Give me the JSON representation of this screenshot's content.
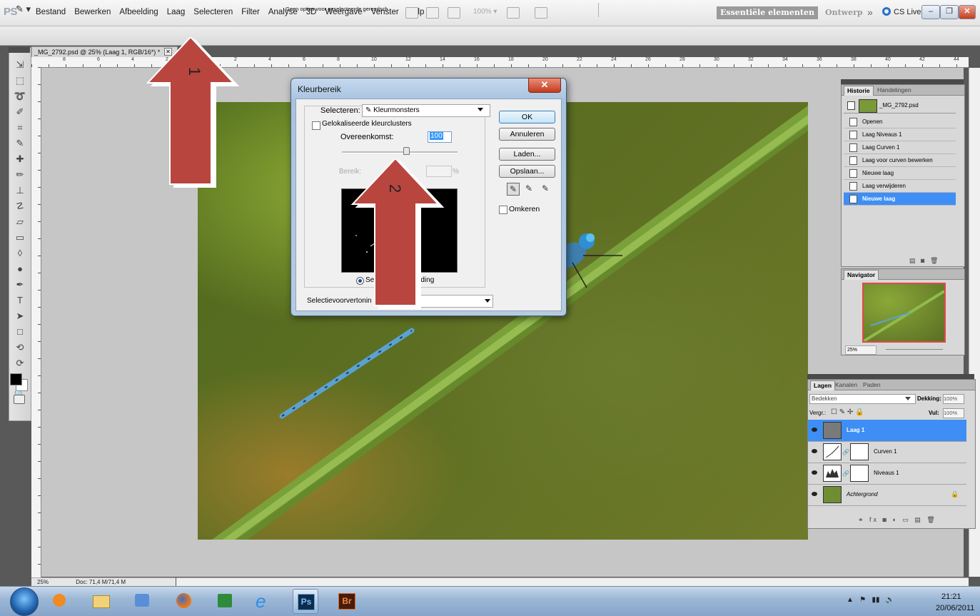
{
  "menubar": {
    "logo": "PS",
    "items": [
      "Bestand",
      "Bewerken",
      "Afbeelding",
      "Laag",
      "Selecteren",
      "Filter",
      "Analyse",
      "3D",
      "Weergave",
      "Venster",
      "Help"
    ],
    "zoom": "100% ▾",
    "workspace_active": "Essentiële elementen",
    "workspace_design": "Ontwerp",
    "more": "»",
    "cslive": "CS Live ▾"
  },
  "options_bar": {
    "message": "Geen opties voor geselecteerde gereedsch."
  },
  "document": {
    "tab_title": "_MG_2792.psd @ 25% (Laag 1, RGB/16*) *",
    "ruler_top_numbers": [
      "8",
      "6",
      "4",
      "2",
      "0",
      "2",
      "4",
      "6",
      "8",
      "10",
      "12",
      "14",
      "16",
      "18",
      "20",
      "22",
      "24",
      "26",
      "28",
      "30",
      "32",
      "34",
      "36",
      "38",
      "40",
      "42",
      "44"
    ],
    "status_zoom": "25%",
    "status_doc": "Doc: 71,4 M/71,4 M"
  },
  "dialog": {
    "title": "Kleurbereik",
    "select_label": "Selecteren:",
    "select_value": "Kleurmonsters",
    "localized_label": "Gelokaliseerde kleurclusters",
    "fuzziness_label": "Overeenkomst:",
    "fuzziness_value": "100",
    "fuzziness_level_pct": 55,
    "range_label": "Bereik:",
    "range_unit": "%",
    "radio_selection": "Sele",
    "radio_image": "eelding",
    "preview_label": "Selectievoorvertonin",
    "buttons": {
      "ok": "OK",
      "cancel": "Annuleren",
      "load": "Laden...",
      "save": "Opslaan..."
    },
    "invert_label": "Omkeren"
  },
  "annotations": {
    "arrow1": "1",
    "arrow2": "2",
    "arrow_color": "#b8463f"
  },
  "history_panel": {
    "tabs": [
      "Historie",
      "Handelingen"
    ],
    "snapshot": "_MG_2792.psd",
    "items": [
      "Openen",
      "Laag Niveaus 1",
      "Laag Curven 1",
      "Laag voor curven bewerken",
      "Nieuwe laag",
      "Laag verwijderen",
      "Nieuwe laag"
    ],
    "selected_index": 6
  },
  "navigator_panel": {
    "tab": "Navigator",
    "zoom": "25%"
  },
  "layers_panel": {
    "tabs": [
      "Lagen",
      "Kanalen",
      "Paden"
    ],
    "blend_mode": "Bedekken",
    "opacity_label": "Dekking:",
    "opacity_value": "100%",
    "lock_label": "Vergr.:",
    "fill_label": "Vul:",
    "fill_value": "100%",
    "layers": [
      {
        "name": "Laag 1",
        "selected": true
      },
      {
        "name": "Curven 1",
        "selected": false
      },
      {
        "name": "Niveaus 1",
        "selected": false
      },
      {
        "name": "Achtergrond",
        "selected": false
      }
    ]
  },
  "taskbar": {
    "apps": [
      "Windows Media Player",
      "Windows Explorer",
      "Photo Gallery",
      "Firefox",
      "Excel",
      "Internet Explorer",
      "Photoshop",
      "Bridge"
    ],
    "ps_label": "Ps",
    "br_label": "Br",
    "time": "21:21",
    "date": "20/06/2011"
  }
}
